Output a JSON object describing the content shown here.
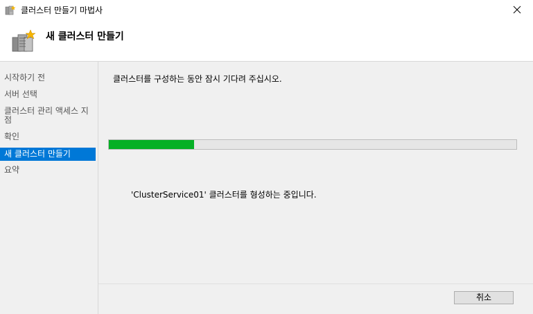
{
  "window": {
    "title": "클러스터 만들기 마법사",
    "close_icon": "close-icon",
    "app_icon": "cluster-wizard-icon"
  },
  "header": {
    "title": "새 클러스터 만들기",
    "icon": "cluster-servers-icon"
  },
  "sidebar": {
    "items": [
      {
        "label": "시작하기 전",
        "active": false
      },
      {
        "label": "서버 선택",
        "active": false
      },
      {
        "label": "클러스터 관리 액세스 지점",
        "active": false
      },
      {
        "label": "확인",
        "active": false
      },
      {
        "label": "새 클러스터 만들기",
        "active": true
      },
      {
        "label": "요약",
        "active": false
      }
    ]
  },
  "main": {
    "message": "클러스터를 구성하는 동안 잠시 기다려 주십시오.",
    "progress_fraction": 0.21,
    "progress_color": "#06b025",
    "status_text": "'ClusterService01' 클러스터를 형성하는 중입니다."
  },
  "footer": {
    "cancel_label": "취소"
  },
  "colors": {
    "accent": "#0078d7",
    "background": "#f0f0f0"
  }
}
